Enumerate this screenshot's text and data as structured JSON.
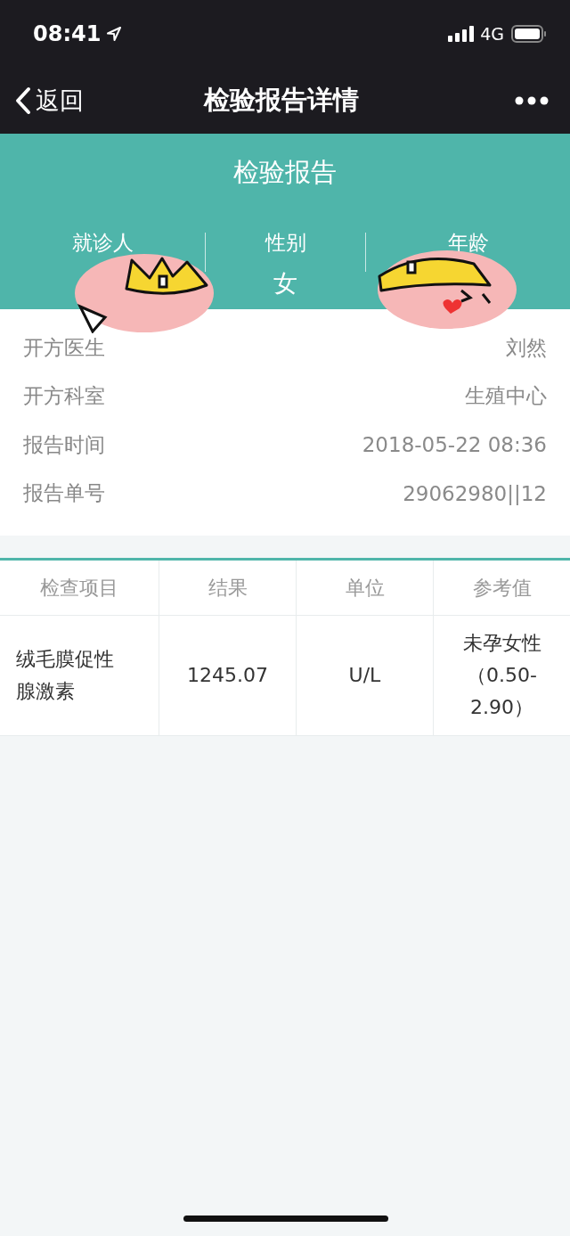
{
  "status_bar": {
    "time": "08:41",
    "network": "4G"
  },
  "nav_bar": {
    "back_label": "返回",
    "title": "检验报告详情"
  },
  "header": {
    "title": "检验报告",
    "fields": [
      {
        "label": "就诊人",
        "covered": true
      },
      {
        "label": "性别",
        "value": "女",
        "covered": false
      },
      {
        "label": "年龄",
        "covered": true
      }
    ]
  },
  "info": [
    {
      "label": "开方医生",
      "value": "刘然"
    },
    {
      "label": "开方科室",
      "value": "生殖中心"
    },
    {
      "label": "报告时间",
      "value": "2018-05-22 08:36"
    },
    {
      "label": "报告单号",
      "value": "29062980||12"
    }
  ],
  "table": {
    "columns": [
      "检查项目",
      "结果",
      "单位",
      "参考值"
    ],
    "rows": [
      [
        "绒毛膜促性腺激素",
        "1245.07",
        "U/L",
        "未孕女性（0.50-2.90）"
      ]
    ]
  }
}
